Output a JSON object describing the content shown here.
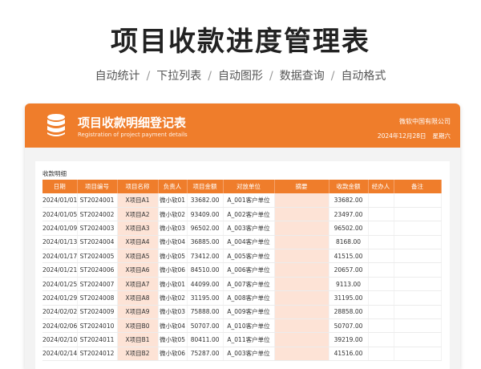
{
  "header": {
    "title": "项目收款进度管理表",
    "features": [
      "自动统计",
      "下拉列表",
      "自动图形",
      "数据查询",
      "自动格式"
    ]
  },
  "sheet": {
    "banner_title": "项目收款明细登记表",
    "banner_subtitle": "Registration of project payment details",
    "company": "微软中国有限公司",
    "date": "2024年12月28日",
    "weekday": "星期六",
    "section_label": "收款明细"
  },
  "colors": {
    "accent": "#ef7d2b",
    "highlight": "#fde3d6"
  },
  "table": {
    "headers": [
      "日期",
      "项目编号",
      "项目名称",
      "负责人",
      "项目金额",
      "对放单位",
      "摘要",
      "收款金额",
      "经办人",
      "备注"
    ],
    "rows": [
      [
        "2024/01/01",
        "ST2024001",
        "X项目A1",
        "微小软01",
        "33682.00",
        "A_001客户单位",
        "",
        "33682.00",
        "",
        ""
      ],
      [
        "2024/01/05",
        "ST2024002",
        "X项目A2",
        "微小软02",
        "93409.00",
        "A_002客户单位",
        "",
        "23497.00",
        "",
        ""
      ],
      [
        "2024/01/09",
        "ST2024003",
        "X项目A3",
        "微小软03",
        "96502.00",
        "A_003客户单位",
        "",
        "96502.00",
        "",
        ""
      ],
      [
        "2024/01/13",
        "ST2024004",
        "X项目A4",
        "微小软04",
        "36885.00",
        "A_004客户单位",
        "",
        "8168.00",
        "",
        ""
      ],
      [
        "2024/01/17",
        "ST2024005",
        "X项目A5",
        "微小软05",
        "73412.00",
        "A_005客户单位",
        "",
        "41515.00",
        "",
        ""
      ],
      [
        "2024/01/21",
        "ST2024006",
        "X项目A6",
        "微小软06",
        "84510.00",
        "A_006客户单位",
        "",
        "20657.00",
        "",
        ""
      ],
      [
        "2024/01/25",
        "ST2024007",
        "X项目A7",
        "微小软01",
        "44099.00",
        "A_007客户单位",
        "",
        "9113.00",
        "",
        ""
      ],
      [
        "2024/01/29",
        "ST2024008",
        "X项目A8",
        "微小软02",
        "31195.00",
        "A_008客户单位",
        "",
        "31195.00",
        "",
        ""
      ],
      [
        "2024/02/02",
        "ST2024009",
        "X项目A9",
        "微小软03",
        "75888.00",
        "A_009客户单位",
        "",
        "28858.00",
        "",
        ""
      ],
      [
        "2024/02/06",
        "ST2024010",
        "X项目B0",
        "微小软04",
        "50707.00",
        "A_010客户单位",
        "",
        "50707.00",
        "",
        ""
      ],
      [
        "2024/02/10",
        "ST2024011",
        "X项目B1",
        "微小软05",
        "80411.00",
        "A_011客户单位",
        "",
        "39219.00",
        "",
        ""
      ],
      [
        "2024/02/14",
        "ST2024012",
        "X项目B2",
        "微小软06",
        "75287.00",
        "A_003客户单位",
        "",
        "41516.00",
        "",
        ""
      ]
    ]
  }
}
